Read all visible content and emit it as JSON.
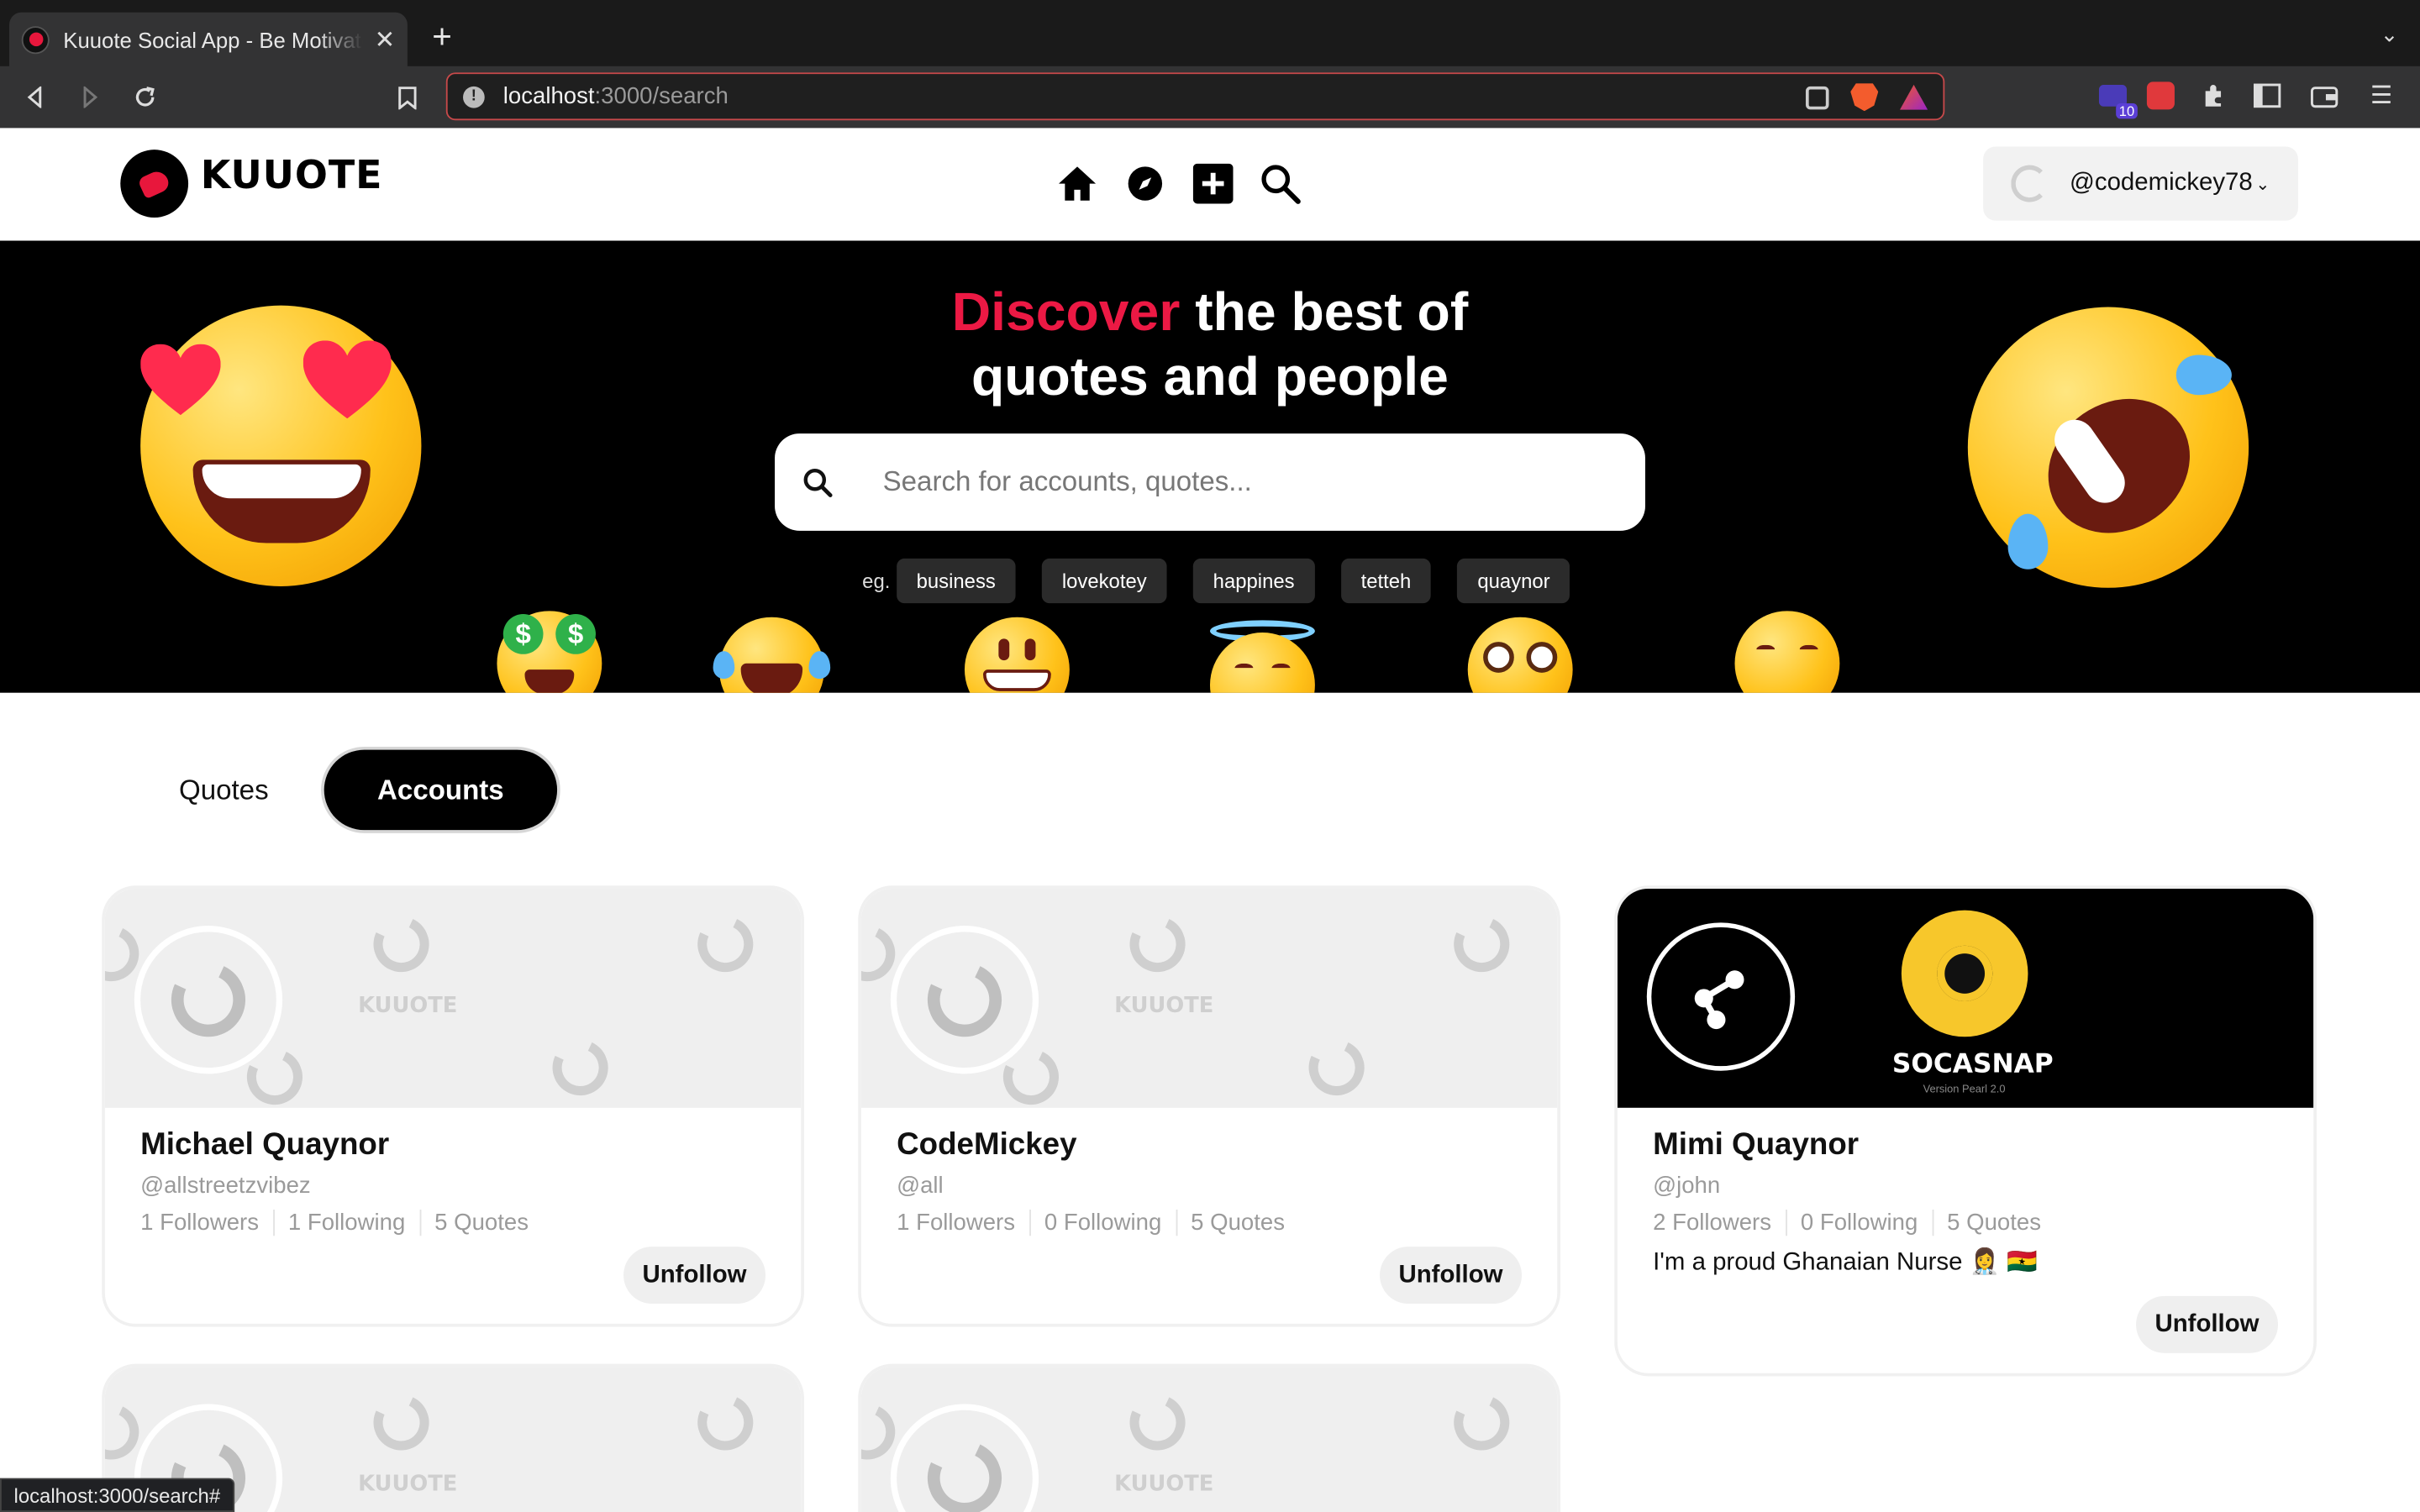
{
  "browser": {
    "tab_title": "Kuuote Social App - Be Motivated",
    "url_host": "localhost",
    "url_path": ":3000/search",
    "extension_badge": "10",
    "status_url": "localhost:3000/search#"
  },
  "header": {
    "logo_text": "KUUOTE",
    "user_handle": "@codemickey78"
  },
  "hero": {
    "title_accent": "Discover",
    "title_line1_rest": " the best of",
    "title_line2": "quotes and people",
    "search_placeholder": "Search for accounts, quotes...",
    "eg_label": "eg.",
    "chips": [
      "business",
      "lovekotey",
      "happines",
      "tetteh",
      "quaynor"
    ]
  },
  "tabs": {
    "quotes": "Quotes",
    "accounts": "Accounts",
    "active": "Accounts"
  },
  "pattern_word": "KUUOTE",
  "accounts": [
    {
      "name": "Michael Quaynor",
      "handle": "@allstreetzvibez",
      "followers": "1 Followers",
      "following": "1 Following",
      "quotes": "5 Quotes",
      "bio": "",
      "button": "Unfollow"
    },
    {
      "name": "CodeMickey",
      "handle": "@all",
      "followers": "1 Followers",
      "following": "0 Following",
      "quotes": "5 Quotes",
      "bio": "",
      "button": "Unfollow"
    },
    {
      "name": "Mimi Quaynor",
      "handle": "@john",
      "followers": "2 Followers",
      "following": "0 Following",
      "quotes": "5 Quotes",
      "bio": "I'm a proud Ghanaian Nurse 👩‍⚕️ 🇬🇭",
      "button": "Unfollow"
    }
  ],
  "socasnap": {
    "word": "SOCASNAP",
    "version": "Version Pearl 2.0"
  },
  "colors": {
    "accent": "#ec1944",
    "hero_bg": "#000000",
    "chip_bg": "#2b2b2b"
  }
}
